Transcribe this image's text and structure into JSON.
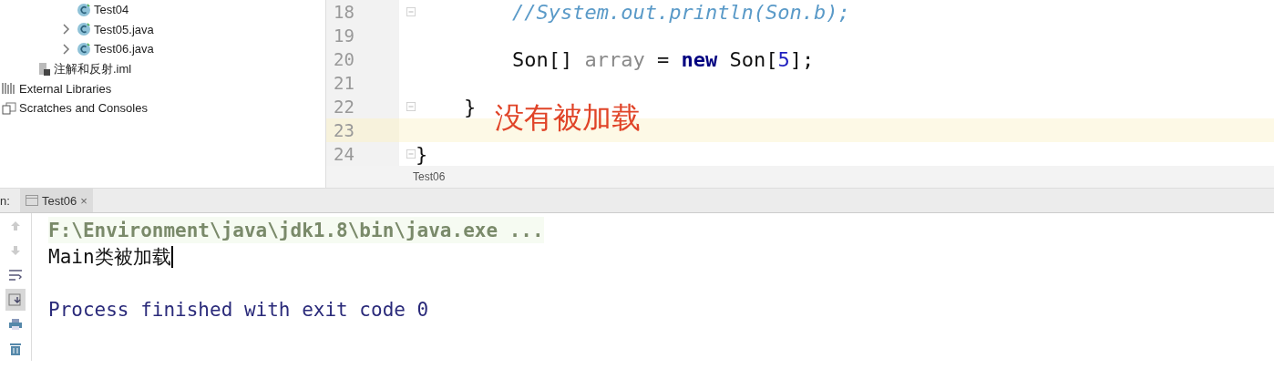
{
  "project_tree": {
    "items": [
      {
        "children": [
          {
            "children": [
              {
                "children": [
                  {
                    "label": "Test04",
                    "kind": "class",
                    "expandable": false
                  },
                  {
                    "label": "Test05.java",
                    "kind": "class",
                    "expandable": true
                  },
                  {
                    "label": "Test06.java",
                    "kind": "class",
                    "expandable": true
                  }
                ]
              }
            ]
          },
          {
            "label": "注解和反射.iml",
            "kind": "iml",
            "expandable": false
          }
        ]
      },
      {
        "label": "External Libraries",
        "kind": "libraries",
        "expandable": false
      },
      {
        "label": "Scratches and Consoles",
        "kind": "scratches",
        "expandable": false
      }
    ]
  },
  "editor": {
    "lines": [
      {
        "number": "18",
        "fold": true,
        "current": false,
        "tokens": [
          {
            "kind": "comment",
            "text": "        //System.out.println(Son.b);"
          }
        ]
      },
      {
        "number": "19",
        "fold": false,
        "current": false
      },
      {
        "number": "20",
        "fold": false,
        "current": false,
        "tokens": [
          {
            "kind": "plain",
            "text": "        Son[] "
          },
          {
            "kind": "variable",
            "text": "array"
          },
          {
            "kind": "plain",
            "text": " = "
          },
          {
            "kind": "keyword",
            "text": "new"
          },
          {
            "kind": "plain",
            "text": " Son["
          },
          {
            "kind": "number",
            "text": "5"
          },
          {
            "kind": "plain",
            "text": "];"
          }
        ]
      },
      {
        "number": "21",
        "fold": false,
        "current": false
      },
      {
        "number": "22",
        "fold": true,
        "current": false,
        "tokens": [
          {
            "kind": "plain",
            "text": "    }"
          }
        ]
      },
      {
        "number": "23",
        "fold": false,
        "current": true
      },
      {
        "number": "24",
        "fold": true,
        "current": false,
        "tokens": [
          {
            "kind": "plain",
            "text": "}"
          }
        ]
      }
    ],
    "annotation": "没有被加载",
    "breadcrumb": "Test06"
  },
  "run_panel": {
    "label": "n:",
    "tabs": [
      {
        "label": "Test06",
        "selected": true,
        "close": "×"
      }
    ],
    "toolbar": [
      {
        "kind": "up",
        "selected": false
      },
      {
        "kind": "down",
        "selected": false
      },
      {
        "kind": "wrap",
        "selected": false
      },
      {
        "kind": "scroll-end",
        "selected": true
      },
      {
        "kind": "print",
        "selected": false
      },
      {
        "kind": "trash",
        "selected": false
      }
    ],
    "console": [
      {
        "kind": "command",
        "text": "F:\\Environment\\java\\jdk1.8\\bin\\java.exe ..."
      },
      {
        "kind": "output",
        "text": "Main类被加载",
        "caret": true
      },
      {
        "kind": "blank"
      },
      {
        "kind": "exit",
        "text": "Process finished with exit code 0"
      }
    ]
  }
}
